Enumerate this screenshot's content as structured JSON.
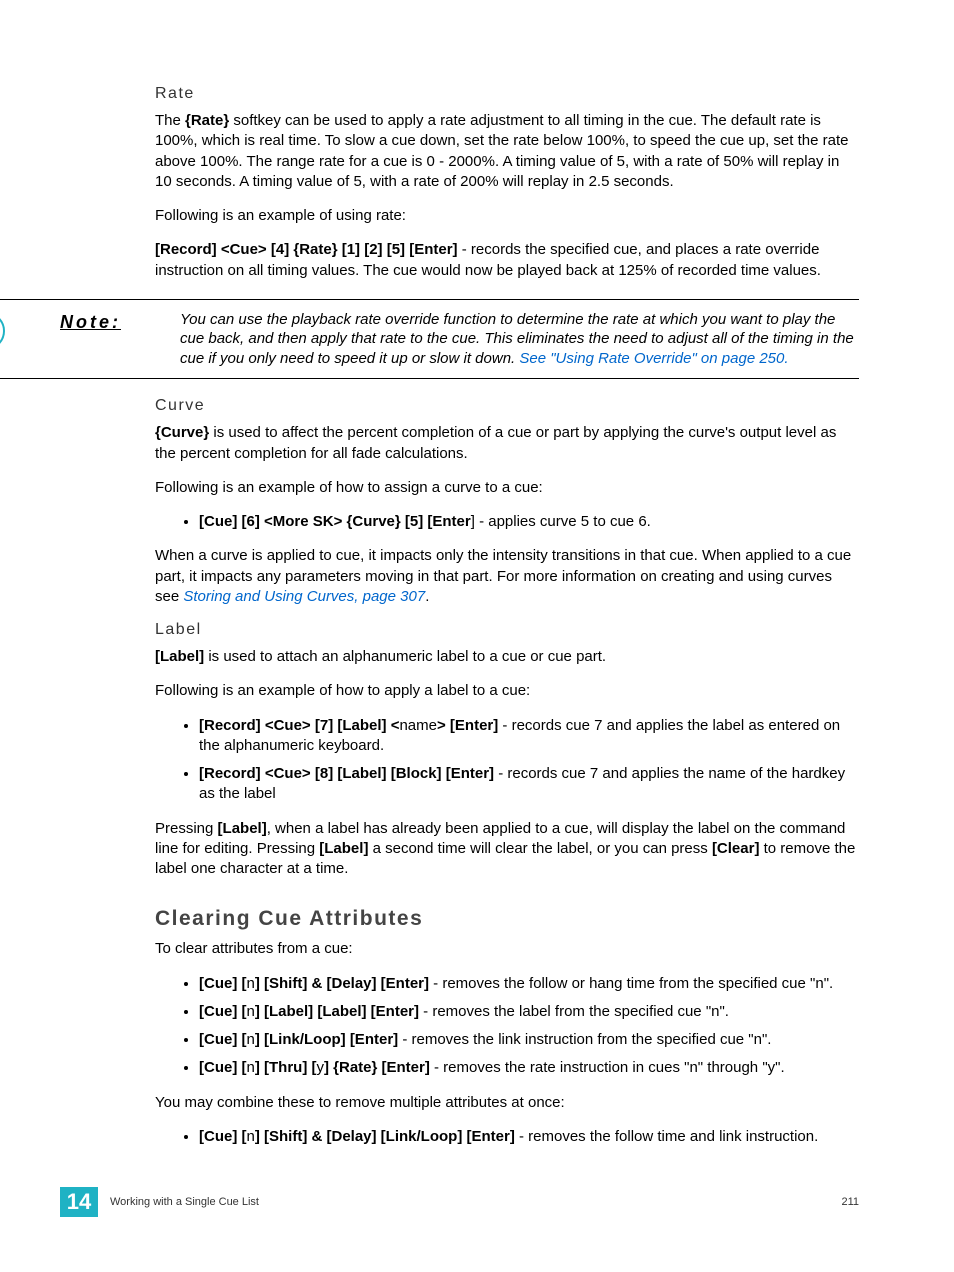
{
  "rate": {
    "heading": "Rate",
    "p1a": "The ",
    "p1b": "{Rate}",
    "p1c": " softkey can be used to apply a rate adjustment to all timing in the cue. The default rate is 100%, which is real time. To slow a cue down, set the rate below 100%, to speed the cue up, set the rate above 100%. The range rate for a cue is 0 - 2000%. A timing value of 5, with a rate of 50% will replay in 10 seconds. A timing value of 5, with a rate of 200% will replay in 2.5 seconds.",
    "p2": "Following is an example of using rate:",
    "p3a": "[Record] <Cue> [4] {Rate} [1] [2] [5] [Enter]",
    "p3b": " - records the specified cue, and places a rate override instruction on all timing values. The cue would now be played back at 125% of recorded time values."
  },
  "note": {
    "label": "Note:",
    "text": "You can use the playback rate override function to determine the rate at which you want to play the cue back, and then apply that rate to the cue. This eliminates the need to adjust all of the timing in the cue if you only need to speed it up or slow it down. ",
    "link": "See \"Using Rate Override\" on page 250."
  },
  "curve": {
    "heading": "Curve",
    "p1a": "{Curve}",
    "p1b": " is used to affect the percent completion of a cue or part by applying the curve's output level as the percent completion for all fade calculations.",
    "p2": "Following is an example of how to assign a curve to a cue:",
    "li1a": "[Cue] [6] <More SK> {Curve} [5] [Enter",
    "li1b": "] - applies curve 5 to cue 6.",
    "p3a": "When a curve is applied to cue, it impacts only the intensity transitions in that cue. When applied to a cue part, it impacts any parameters moving in that part. For more information on creating and using curves see ",
    "p3link": "Storing and Using Curves, page 307",
    "p3c": "."
  },
  "label": {
    "heading": "Label",
    "p1a": "[Label]",
    "p1b": " is used to attach an alphanumeric label to a cue or cue part.",
    "p2": "Following is an example of how to apply a label to a cue:",
    "li1a": "[Record] <Cue> [7] [Label] <",
    "li1b": "name",
    "li1c": "> [Enter]",
    "li1d": " - records cue 7 and applies the label as entered on the alphanumeric keyboard.",
    "li2a": "[Record] <Cue> [8] [Label] [Block] [Enter]",
    "li2b": " - records cue 7 and applies the name of the hardkey as the label",
    "p3a": "Pressing ",
    "p3b": "[Label]",
    "p3c": ", when a label has already been applied to a cue, will display the label on the command line for editing. Pressing ",
    "p3d": "[Label]",
    "p3e": " a second time will clear the label, or you can press ",
    "p3f": "[Clear]",
    "p3g": " to remove the label one character at a time."
  },
  "clearing": {
    "heading": "Clearing Cue Attributes",
    "p1": "To clear attributes from a cue:",
    "li1a": "[Cue] [",
    "li1b": "n",
    "li1c": "] [Shift] & [Delay] [Enter]",
    "li1d": " - removes the follow or hang time from the specified cue \"n\".",
    "li2a": "[Cue] [",
    "li2b": "n",
    "li2c": "] [Label] [Label] [Enter]",
    "li2d": " - removes the label from the specified cue \"n\".",
    "li3a": "[Cue] [",
    "li3b": "n",
    "li3c": "] [Link/Loop] [Enter]",
    "li3d": " - removes the link instruction from the specified cue \"n\".",
    "li4a": "[Cue] [",
    "li4b": "n",
    "li4c": "] [Thru] [",
    "li4d": "y",
    "li4e": "] {Rate} [Enter]",
    "li4f": " - removes the rate instruction in cues \"n\" through \"y\".",
    "p2": "You may combine these to remove multiple attributes at once:",
    "li5a": "[Cue] [",
    "li5b": "n",
    "li5c": "] [Shift] & [Delay] [Link/Loop] [Enter]",
    "li5d": " - removes the follow time and link instruction."
  },
  "footer": {
    "chapter": "14",
    "title": "Working with a Single Cue List",
    "page": "211"
  }
}
